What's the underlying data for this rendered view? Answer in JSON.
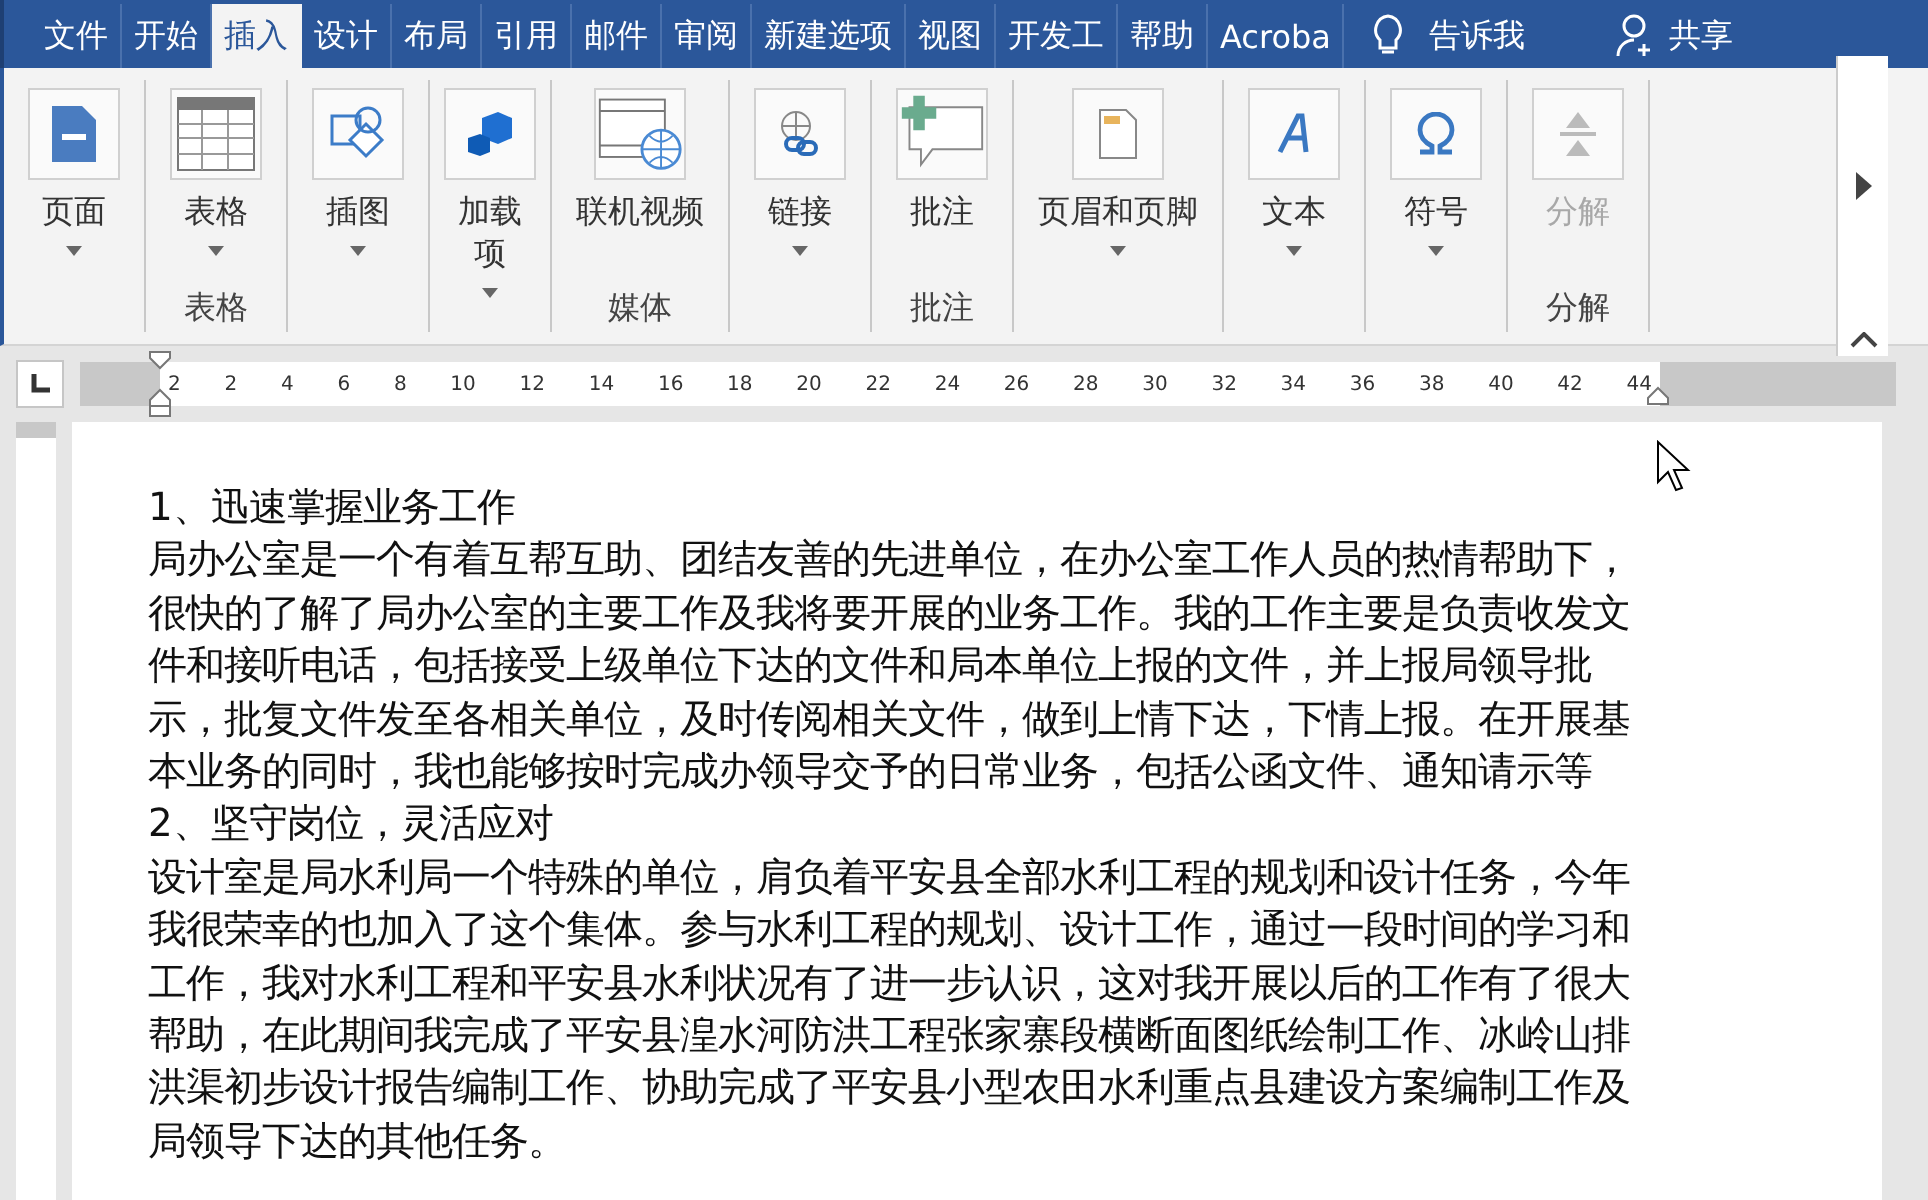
{
  "tabs": [
    {
      "label": "文件",
      "selected": false
    },
    {
      "label": "开始",
      "selected": false
    },
    {
      "label": "插入",
      "selected": true
    },
    {
      "label": "设计",
      "selected": false
    },
    {
      "label": "布局",
      "selected": false
    },
    {
      "label": "引用",
      "selected": false
    },
    {
      "label": "邮件",
      "selected": false
    },
    {
      "label": "审阅",
      "selected": false
    },
    {
      "label": "新建选项",
      "selected": false
    },
    {
      "label": "视图",
      "selected": false
    },
    {
      "label": "开发工",
      "selected": false
    },
    {
      "label": "帮助",
      "selected": false
    },
    {
      "label": "Acroba",
      "selected": false
    }
  ],
  "tell_me": "告诉我",
  "share": "共享",
  "ribbon_groups": [
    {
      "buttons": [
        {
          "label": "页面",
          "kind": "page",
          "dropdown": true,
          "disabled": false
        }
      ]
    },
    {
      "label": "表格",
      "buttons": [
        {
          "label": "表格",
          "kind": "table",
          "dropdown": true,
          "disabled": false
        }
      ]
    },
    {
      "buttons": [
        {
          "label": "插图",
          "kind": "shapes",
          "dropdown": true,
          "disabled": false
        }
      ]
    },
    {
      "buttons": [
        {
          "label": "加载项",
          "kind": "addin",
          "dropdown": true,
          "disabled": false
        }
      ]
    },
    {
      "label": "媒体",
      "buttons": [
        {
          "label": "联机视频",
          "kind": "video",
          "dropdown": false,
          "disabled": false
        }
      ]
    },
    {
      "buttons": [
        {
          "label": "链接",
          "kind": "link",
          "dropdown": true,
          "disabled": false
        }
      ]
    },
    {
      "label": "批注",
      "buttons": [
        {
          "label": "批注",
          "kind": "comment",
          "dropdown": false,
          "disabled": false
        }
      ]
    },
    {
      "buttons": [
        {
          "label": "页眉和页脚",
          "kind": "header",
          "dropdown": true,
          "disabled": false
        }
      ]
    },
    {
      "buttons": [
        {
          "label": "文本",
          "kind": "text",
          "dropdown": true,
          "disabled": false
        }
      ]
    },
    {
      "buttons": [
        {
          "label": "符号",
          "kind": "symbol",
          "dropdown": true,
          "disabled": false
        }
      ]
    },
    {
      "label": "分解",
      "buttons": [
        {
          "label": "分解",
          "kind": "split",
          "dropdown": false,
          "disabled": true
        }
      ]
    }
  ],
  "ruler": [
    "2",
    "2",
    "4",
    "6",
    "8",
    "10",
    "12",
    "14",
    "16",
    "18",
    "20",
    "22",
    "24",
    "26",
    "28",
    "30",
    "32",
    "34",
    "36",
    "38",
    "40",
    "42",
    "44"
  ],
  "document": [
    {
      "lines": [
        "1、迅速掌握业务工作"
      ]
    },
    {
      "lines": [
        "局办公室是一个有着互帮互助、团结友善的先进单位，在办公室工作人员的热情帮助下，",
        "很快的了解了局办公室的主要工作及我将要开展的业务工作。我的工作主要是负责收发文",
        "件和接听电话，包括接受上级单位下达的文件和局本单位上报的文件，并上报局领导批",
        "示，批复文件发至各相关单位，及时传阅相关文件，做到上情下达，下情上报。在开展基",
        "本业务的同时，我也能够按时完成办领导交予的日常业务，包括公函文件、通知请示等"
      ]
    },
    {
      "lines": [
        "2、坚守岗位，灵活应对"
      ]
    },
    {
      "lines": [
        "设计室是局水利局一个特殊的单位，肩负着平安县全部水利工程的规划和设计任务，今年",
        "我很荣幸的也加入了这个集体。参与水利工程的规划、设计工作，通过一段时间的学习和",
        "工作，我对水利工程和平安县水利状况有了进一步认识，这对我开展以后的工作有了很大",
        "帮助，在此期间我完成了平安县湟水河防洪工程张家寨段横断面图纸绘制工作、冰岭山排",
        "洪渠初步设计报告编制工作、协助完成了平安县小型农田水利重点县建设方案编制工作及",
        "局领导下达的其他任务。"
      ]
    }
  ]
}
